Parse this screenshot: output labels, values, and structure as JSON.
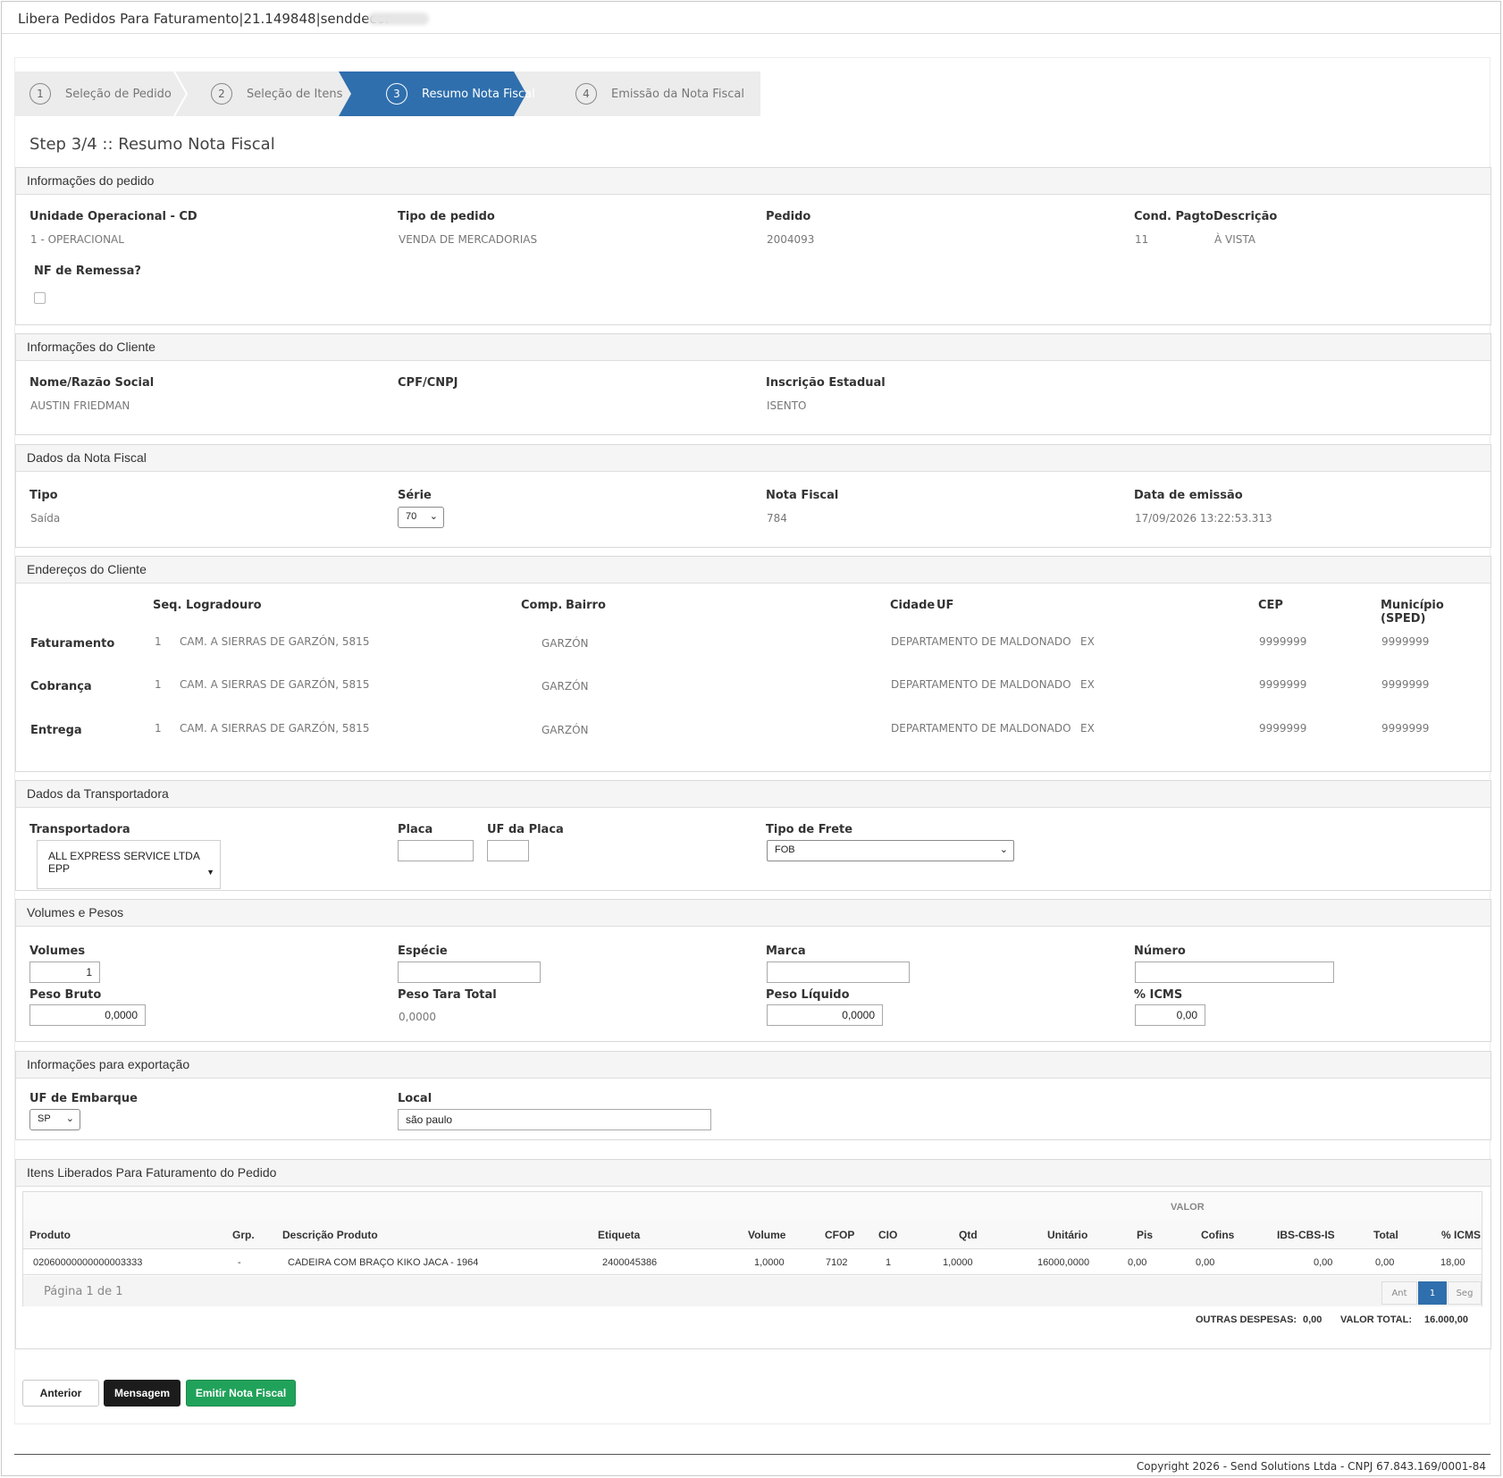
{
  "window": {
    "title": "Libera Pedidos Para Faturamento|21.149848|senddecor"
  },
  "wizard": {
    "steps": [
      {
        "num": "1",
        "label": "Seleção de Pedido"
      },
      {
        "num": "2",
        "label": "Seleção de Itens"
      },
      {
        "num": "3",
        "label": "Resumo Nota Fiscal"
      },
      {
        "num": "4",
        "label": "Emissão da Nota Fiscal"
      }
    ],
    "active_color": "#2f6fad",
    "heading": "Step 3/4 :: Resumo Nota Fiscal"
  },
  "pedido": {
    "title": "Informações do pedido",
    "unidade_label": "Unidade Operacional - CD",
    "unidade_value": "1 - OPERACIONAL",
    "tipo_label": "Tipo de pedido",
    "tipo_value": "VENDA DE MERCADORIAS",
    "pedido_label": "Pedido",
    "pedido_value": "2004093",
    "cond_label": "Cond. Pagto",
    "cond_value": "11",
    "desc_label": "Descrição",
    "desc_value": "À VISTA",
    "remessa_label": "NF de Remessa?"
  },
  "cliente": {
    "title": "Informações do Cliente",
    "nome_label": "Nome/Razão Social",
    "nome_value": "AUSTIN FRIEDMAN",
    "cpf_label": "CPF/CNPJ",
    "cpf_value": "",
    "ie_label": "Inscrição Estadual",
    "ie_value": "ISENTO"
  },
  "nota": {
    "title": "Dados da Nota Fiscal",
    "tipo_label": "Tipo",
    "tipo_value": "Saída",
    "serie_label": "Série",
    "serie_value": "70",
    "nf_label": "Nota Fiscal",
    "nf_value": "784",
    "data_label": "Data de emissão",
    "data_value": "17/09/2026 13:22:53.313"
  },
  "enderecos": {
    "title": "Endereços do Cliente",
    "headers": {
      "seq": "Seq.",
      "logradouro": "Logradouro",
      "comp": "Comp.",
      "bairro": "Bairro",
      "cidade": "Cidade",
      "uf": "UF",
      "cep": "CEP",
      "municipio": "Município (SPED)"
    },
    "rows": [
      {
        "tipo": "Faturamento",
        "seq": "1",
        "logradouro": "CAM. A SIERRAS DE GARZÓN, 5815",
        "bairro": "GARZÓN",
        "cidade": "DEPARTAMENTO DE MALDONADO",
        "uf": "EX",
        "cep": "9999999",
        "municipio": "9999999"
      },
      {
        "tipo": "Cobrança",
        "seq": "1",
        "logradouro": "CAM. A SIERRAS DE GARZÓN, 5815",
        "bairro": "GARZÓN",
        "cidade": "DEPARTAMENTO DE MALDONADO",
        "uf": "EX",
        "cep": "9999999",
        "municipio": "9999999"
      },
      {
        "tipo": "Entrega",
        "seq": "1",
        "logradouro": "CAM. A SIERRAS DE GARZÓN, 5815",
        "bairro": "GARZÓN",
        "cidade": "DEPARTAMENTO DE MALDONADO",
        "uf": "EX",
        "cep": "9999999",
        "municipio": "9999999"
      }
    ]
  },
  "transportadora": {
    "title": "Dados da Transportadora",
    "transp_label": "Transportadora",
    "transp_value": "ALL EXPRESS SERVICE LTDA EPP",
    "placa_label": "Placa",
    "placa_value": "",
    "ufplaca_label": "UF da Placa",
    "ufplaca_value": "",
    "frete_label": "Tipo de Frete",
    "frete_value": "FOB"
  },
  "volumes": {
    "title": "Volumes e Pesos",
    "volumes_label": "Volumes",
    "volumes_value": "1",
    "especie_label": "Espécie",
    "especie_value": "",
    "marca_label": "Marca",
    "marca_value": "",
    "numero_label": "Número",
    "numero_value": "",
    "bruto_label": "Peso Bruto",
    "bruto_value": "0,0000",
    "tara_label": "Peso Tara Total",
    "tara_value": "0,0000",
    "liquido_label": "Peso Líquido",
    "liquido_value": "0,0000",
    "icms_label": "% ICMS",
    "icms_value": "0,00"
  },
  "exportacao": {
    "title": "Informações para exportação",
    "uf_label": "UF de Embarque",
    "uf_value": "SP",
    "local_label": "Local",
    "local_value": "são paulo"
  },
  "itens": {
    "title": "Itens Liberados Para Faturamento do Pedido",
    "group_header": "VALOR",
    "headers": {
      "produto": "Produto",
      "grp": "Grp.",
      "descricao": "Descrição Produto",
      "etiqueta": "Etiqueta",
      "volume": "Volume",
      "cfop": "CFOP",
      "cio": "CIO",
      "qtd": "Qtd",
      "unitario": "Unitário",
      "pis": "Pis",
      "cofins": "Cofins",
      "ibs": "IBS-CBS-IS",
      "total": "Total",
      "icms": "% ICMS"
    },
    "rows": [
      {
        "produto": "02060000000000003333",
        "grp": "-",
        "descricao": "CADEIRA COM BRAÇO KIKO JACA - 1964",
        "etiqueta": "2400045386",
        "volume": "1,0000",
        "cfop": "7102",
        "cio": "1",
        "qtd": "1,0000",
        "unitario": "16000,0000",
        "pis": "0,00",
        "cofins": "0,00",
        "ibs": "0,00",
        "total": "0,00",
        "icms": "18,00"
      }
    ],
    "pagina": "Página 1 de 1",
    "pager": {
      "prev": "Ant",
      "current": "1",
      "next": "Seg"
    },
    "outras_label": "OUTRAS DESPESAS:",
    "outras_value": "0,00",
    "total_label": "VALOR TOTAL:",
    "total_value": "16.000,00"
  },
  "buttons": {
    "anterior": "Anterior",
    "mensagem": "Mensagem",
    "emitir": "Emitir Nota Fiscal"
  },
  "footer": {
    "copyright": "Copyright 2026 - Send Solutions Ltda - CNPJ 67.843.169/0001-84"
  },
  "colors": {
    "accent": "#2f6fad",
    "success": "#21a25a",
    "dark": "#1c1c1c"
  }
}
